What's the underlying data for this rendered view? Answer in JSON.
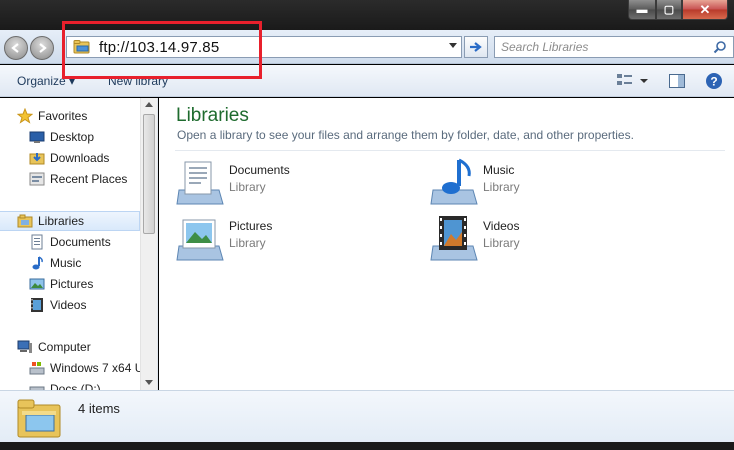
{
  "window": {
    "controls": {
      "minimize": "▬",
      "maximize": "▢",
      "close": "✕"
    }
  },
  "nav": {
    "address_value": "ftp://103.14.97.85",
    "search_placeholder": "Search Libraries"
  },
  "toolbar": {
    "organize_label": "Organize ▾",
    "new_library_label": "New library"
  },
  "sidebar": {
    "items": [
      {
        "label": "Favorites",
        "icon": "star-icon"
      },
      {
        "label": "Desktop",
        "icon": "desktop-icon"
      },
      {
        "label": "Downloads",
        "icon": "downloads-icon"
      },
      {
        "label": "Recent Places",
        "icon": "recent-places-icon"
      },
      {
        "label": "Libraries",
        "icon": "libraries-icon"
      },
      {
        "label": "Documents",
        "icon": "documents-icon"
      },
      {
        "label": "Music",
        "icon": "music-icon"
      },
      {
        "label": "Pictures",
        "icon": "pictures-icon"
      },
      {
        "label": "Videos",
        "icon": "videos-icon"
      },
      {
        "label": "Computer",
        "icon": "computer-icon"
      },
      {
        "label": "Windows 7 x64 U",
        "icon": "drive-icon"
      },
      {
        "label": "Docs (D:)",
        "icon": "drive-icon"
      }
    ]
  },
  "main": {
    "title": "Libraries",
    "subtitle": "Open a library to see your files and arrange them by folder, date, and other properties.",
    "libraries": [
      {
        "name": "Documents",
        "type": "Library",
        "icon": "documents-library-icon"
      },
      {
        "name": "Music",
        "type": "Library",
        "icon": "music-library-icon"
      },
      {
        "name": "Pictures",
        "type": "Library",
        "icon": "pictures-library-icon"
      },
      {
        "name": "Videos",
        "type": "Library",
        "icon": "videos-library-icon"
      }
    ]
  },
  "details": {
    "item_count": "4 items"
  },
  "colors": {
    "accent_green": "#1e6b2e",
    "highlight_red": "#e8202c",
    "link_blue": "#1e3a5c"
  }
}
